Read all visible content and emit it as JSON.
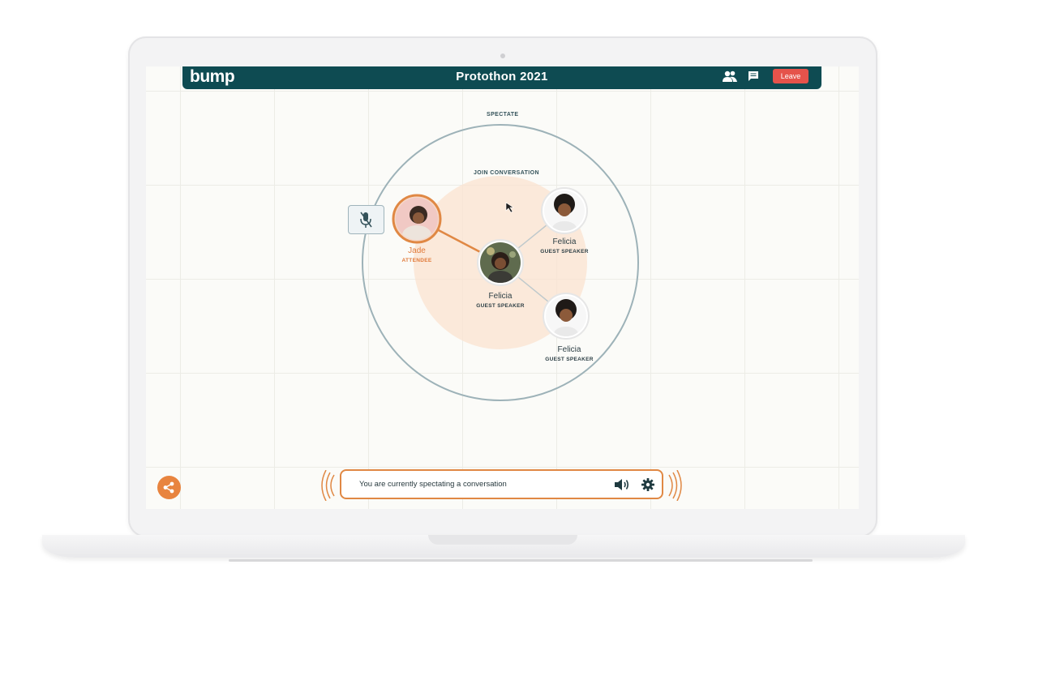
{
  "app": {
    "logo": "bump",
    "title": "Protothon 2021",
    "leave_label": "Leave",
    "icons": [
      "people-icon",
      "chat-icon"
    ],
    "accent_color": "#e08844",
    "header_color": "#0e4b52",
    "leave_color": "#e5534b"
  },
  "zones": {
    "spectate": "SPECTATE",
    "join": "JOIN CONVERSATION"
  },
  "participants": [
    {
      "name": "Jade",
      "role": "ATTENDEE",
      "muted": true
    },
    {
      "name": "Felicia",
      "role": "GUEST SPEAKER"
    },
    {
      "name": "Felicia",
      "role": "GUEST SPEAKER"
    },
    {
      "name": "Felicia",
      "role": "GUEST SPEAKER"
    }
  ],
  "status": {
    "text": "You are currently spectating a conversation",
    "icons": [
      "volume-icon",
      "gear-icon"
    ]
  },
  "share": {
    "icon": "share-icon"
  }
}
